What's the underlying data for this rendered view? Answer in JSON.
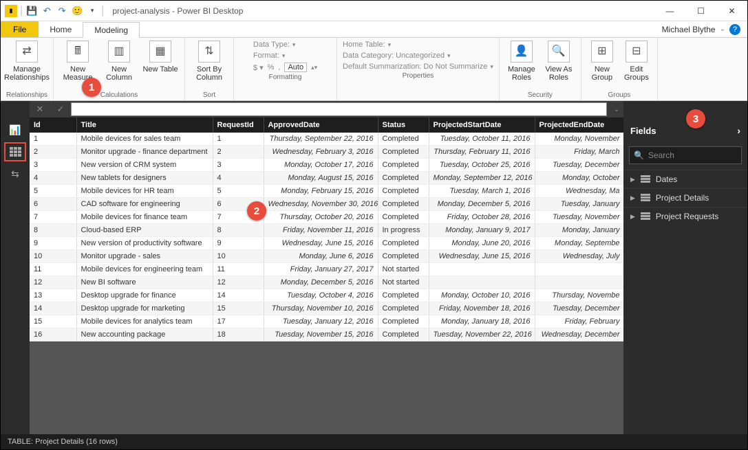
{
  "app": {
    "title": "project-analysis - Power BI Desktop",
    "user": "Michael Blythe"
  },
  "tabs": {
    "file": "File",
    "home": "Home",
    "modeling": "Modeling"
  },
  "ribbon": {
    "relationships": {
      "label": "Relationships",
      "manage": "Manage Relationships"
    },
    "calculations": {
      "label": "Calculations",
      "newMeasure": "New Measure",
      "newColumn": "New Column",
      "newTable": "New Table"
    },
    "sort": {
      "label": "Sort",
      "sortBy": "Sort By Column"
    },
    "formatting": {
      "label": "Formatting",
      "dataType": "Data Type:",
      "format": "Format:",
      "auto": "Auto"
    },
    "properties": {
      "label": "Properties",
      "homeTable": "Home Table:",
      "dataCategory": "Data Category: Uncategorized",
      "defaultSum": "Default Summarization: Do Not Summarize"
    },
    "security": {
      "label": "Security",
      "manageRoles": "Manage Roles",
      "viewAs": "View As Roles"
    },
    "groups": {
      "label": "Groups",
      "newGroup": "New Group",
      "editGroups": "Edit Groups"
    }
  },
  "fieldsPane": {
    "title": "Fields",
    "searchPlaceholder": "Search",
    "tables": [
      "Dates",
      "Project Details",
      "Project Requests"
    ]
  },
  "table": {
    "columns": [
      "Id",
      "Title",
      "RequestId",
      "ApprovedDate",
      "Status",
      "ProjectedStartDate",
      "ProjectedEndDate"
    ],
    "rows": [
      {
        "id": "1",
        "title": "Mobile devices for sales team",
        "req": "1",
        "appr": "Thursday, September 22, 2016",
        "status": "Completed",
        "pstart": "Tuesday, October 11, 2016",
        "pend": "Monday, November"
      },
      {
        "id": "2",
        "title": "Monitor upgrade - finance department",
        "req": "2",
        "appr": "Wednesday, February 3, 2016",
        "status": "Completed",
        "pstart": "Thursday, February 11, 2016",
        "pend": "Friday, March"
      },
      {
        "id": "3",
        "title": "New version of CRM system",
        "req": "3",
        "appr": "Monday, October 17, 2016",
        "status": "Completed",
        "pstart": "Tuesday, October 25, 2016",
        "pend": "Tuesday, December"
      },
      {
        "id": "4",
        "title": "New tablets for designers",
        "req": "4",
        "appr": "Monday, August 15, 2016",
        "status": "Completed",
        "pstart": "Monday, September 12, 2016",
        "pend": "Monday, October"
      },
      {
        "id": "5",
        "title": "Mobile devices for HR team",
        "req": "5",
        "appr": "Monday, February 15, 2016",
        "status": "Completed",
        "pstart": "Tuesday, March 1, 2016",
        "pend": "Wednesday, Ma"
      },
      {
        "id": "6",
        "title": "CAD software for engineering",
        "req": "6",
        "appr": "Wednesday, November 30, 2016",
        "status": "Completed",
        "pstart": "Monday, December 5, 2016",
        "pend": "Tuesday, January"
      },
      {
        "id": "7",
        "title": "Mobile devices for finance team",
        "req": "7",
        "appr": "Thursday, October 20, 2016",
        "status": "Completed",
        "pstart": "Friday, October 28, 2016",
        "pend": "Tuesday, November"
      },
      {
        "id": "8",
        "title": "Cloud-based ERP",
        "req": "8",
        "appr": "Friday, November 11, 2016",
        "status": "In progress",
        "pstart": "Monday, January 9, 2017",
        "pend": "Monday, January"
      },
      {
        "id": "9",
        "title": "New version of productivity software",
        "req": "9",
        "appr": "Wednesday, June 15, 2016",
        "status": "Completed",
        "pstart": "Monday, June 20, 2016",
        "pend": "Monday, Septembe"
      },
      {
        "id": "10",
        "title": "Monitor upgrade - sales",
        "req": "10",
        "appr": "Monday, June 6, 2016",
        "status": "Completed",
        "pstart": "Wednesday, June 15, 2016",
        "pend": "Wednesday, July"
      },
      {
        "id": "11",
        "title": "Mobile devices for engineering team",
        "req": "11",
        "appr": "Friday, January 27, 2017",
        "status": "Not started",
        "pstart": "",
        "pend": ""
      },
      {
        "id": "12",
        "title": "New BI software",
        "req": "12",
        "appr": "Monday, December 5, 2016",
        "status": "Not started",
        "pstart": "",
        "pend": ""
      },
      {
        "id": "13",
        "title": "Desktop upgrade for finance",
        "req": "14",
        "appr": "Tuesday, October 4, 2016",
        "status": "Completed",
        "pstart": "Monday, October 10, 2016",
        "pend": "Thursday, Novembe"
      },
      {
        "id": "14",
        "title": "Desktop upgrade for marketing",
        "req": "15",
        "appr": "Thursday, November 10, 2016",
        "status": "Completed",
        "pstart": "Friday, November 18, 2016",
        "pend": "Tuesday, December"
      },
      {
        "id": "15",
        "title": "Mobile devices for analytics team",
        "req": "17",
        "appr": "Tuesday, January 12, 2016",
        "status": "Completed",
        "pstart": "Monday, January 18, 2016",
        "pend": "Friday, February"
      },
      {
        "id": "16",
        "title": "New accounting package",
        "req": "18",
        "appr": "Tuesday, November 15, 2016",
        "status": "Completed",
        "pstart": "Tuesday, November 22, 2016",
        "pend": "Wednesday, December"
      }
    ]
  },
  "status": "TABLE: Project Details (16 rows)",
  "callouts": {
    "c1": "1",
    "c2": "2",
    "c3": "3"
  }
}
